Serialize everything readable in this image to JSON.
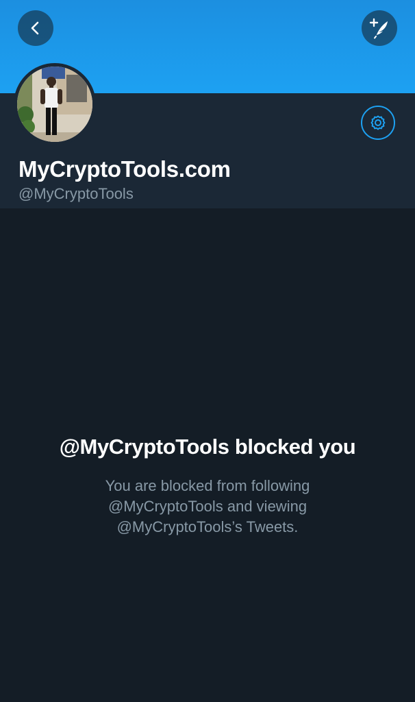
{
  "profile": {
    "display_name": "MyCryptoTools.com",
    "handle": "@MyCryptoTools"
  },
  "blocked": {
    "title": "@MyCryptoTools blocked you",
    "message": "You are blocked from following @MyCryptoTools and viewing @MyCryptoTools’s Tweets."
  },
  "icons": {
    "back": "back-arrow-icon",
    "compose": "compose-tweet-icon",
    "settings": "gear-icon",
    "avatar": "profile-photo"
  },
  "colors": {
    "accent": "#1da1f2",
    "background": "#141d26",
    "header_panel": "#1b2836",
    "secondary_text": "#8899a6",
    "primary_text": "#ffffff"
  }
}
